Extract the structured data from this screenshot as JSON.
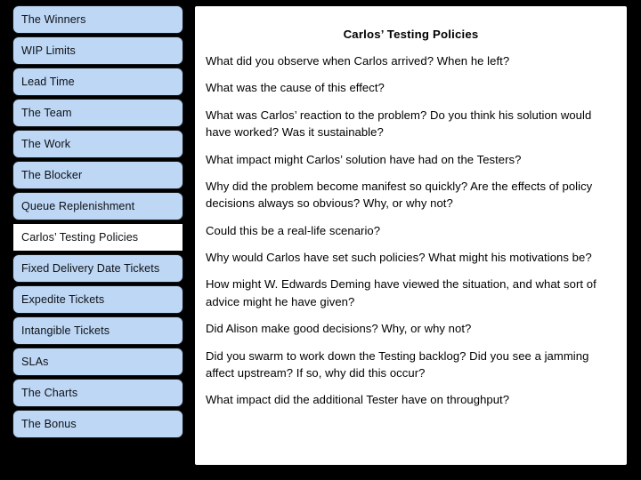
{
  "slide": {
    "background_color": "#000000",
    "accent_color": "#bdd7f5",
    "selected_color": "#ffffff"
  },
  "sidebar": {
    "items": [
      {
        "label": "The Winners",
        "selected": false
      },
      {
        "label": "WIP Limits",
        "selected": false
      },
      {
        "label": "Lead Time",
        "selected": false
      },
      {
        "label": "The Team",
        "selected": false
      },
      {
        "label": "The Work",
        "selected": false
      },
      {
        "label": "The Blocker",
        "selected": false
      },
      {
        "label": "Queue Replenishment",
        "selected": false
      },
      {
        "label": "Carlos’ Testing Policies",
        "selected": true
      },
      {
        "label": "Fixed Delivery Date Tickets",
        "selected": false
      },
      {
        "label": "Expedite Tickets",
        "selected": false
      },
      {
        "label": "Intangible Tickets",
        "selected": false
      },
      {
        "label": "SLAs",
        "selected": false
      },
      {
        "label": "The Charts",
        "selected": false
      },
      {
        "label": "The Bonus",
        "selected": false
      }
    ]
  },
  "panel": {
    "title": "Carlos’ Testing Policies",
    "questions": [
      "What did you observe when Carlos arrived? When he left?",
      "What was the cause of this effect?",
      "What was Carlos’ reaction to the problem? Do you think his solution would have worked? Was it sustainable?",
      "What impact might Carlos’ solution have had on the Testers?",
      "Why did the problem become manifest so quickly? Are the effects of policy decisions always so obvious? Why, or why not?",
      "Could this be a real-life scenario?",
      "Why would Carlos have set such policies? What might his motivations be?",
      "How might W. Edwards Deming have viewed the situation, and what sort of advice might he have given?",
      "Did Alison make good decisions? Why, or why not?",
      "Did you swarm to work down the Testing backlog? Did you see a jamming affect upstream? If so, why did this occur?",
      "What impact did the additional Tester have on throughput?"
    ]
  }
}
